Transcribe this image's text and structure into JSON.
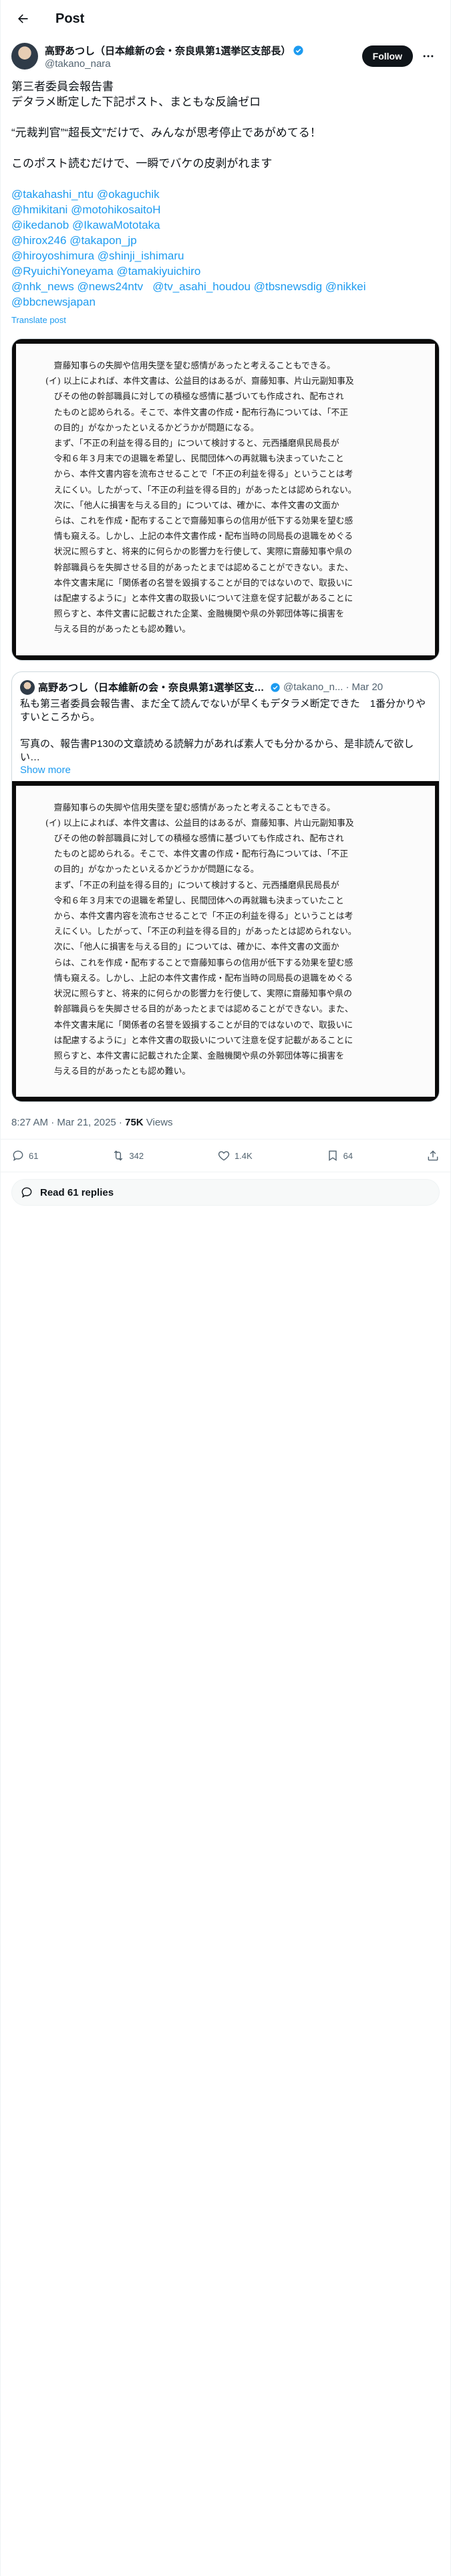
{
  "header": {
    "title": "Post"
  },
  "author": {
    "name": "高野あつし（日本維新の会・奈良県第1選挙区支部長）",
    "handle": "@takano_nara",
    "follow_label": "Follow"
  },
  "post": {
    "line1": "第三者委員会報告書",
    "line2": "デタラメ断定した下記ポスト、まともな反論ゼロ",
    "line3": "“元裁判官”“超長文”だけで、みんなが思考停止であがめてる！",
    "line4": "このポスト読むだけで、一瞬でバケの皮剥がれます",
    "mentions": [
      "@takahashi_ntu",
      "@okaguchik",
      "@hmikitani",
      "@motohikosaitoH",
      "@ikedanob",
      "@IkawaMototaka",
      "@hirox246",
      "@takapon_jp",
      "@hiroyoshimura",
      "@shinji_ishimaru",
      "@RyuichiYoneyama",
      "@tamakiyuichiro",
      "@nhk_news",
      "@news24ntv",
      "@tv_asahi_houdou",
      "@tbsnewsdig",
      "@nikkei",
      "@bbcnewsjapan"
    ],
    "translate_label": "Translate post"
  },
  "document": {
    "l1": "齋藤知事らの失脚や信用失墜を望む感情があったと考えることもできる。",
    "l2": "(イ) 以上によれば、本件文書は、公益目的はあるが、齋藤知事、片山元副知事及",
    "l3": "びその他の幹部職員に対しての積極な感情に基づいても作成され、配布され",
    "l4": "たものと認められる。そこで、本件文書の作成・配布行為については、「不正",
    "l5": "の目的」がなかったといえるかどうかが問題になる。",
    "l6": "まず、「不正の利益を得る目的」について検討すると、元西播磨県民局長が",
    "l7": "令和６年３月末での退職を希望し、民間団体への再就職も決まっていたこと",
    "l8": "から、本件文書内容を流布させることで「不正の利益を得る」ということは考",
    "l9": "えにくい。したがって、「不正の利益を得る目的」があったとは認められない。",
    "l10": "次に、「他人に損害を与える目的」については、確かに、本件文書の文面か",
    "l11": "らは、これを作成・配布することで齋藤知事らの信用が低下する効果を望む感",
    "l12": "情も窺える。しかし、上記の本件文書作成・配布当時の同局長の退職をめぐる",
    "l13": "状況に照らすと、将来的に何らかの影響力を行使して、実際に齋藤知事や県の",
    "l14": "幹部職員らを失脚させる目的があったとまでは認めることができない。また、",
    "l15": "本件文書末尾に「関係者の名誉を毀損することが目的ではないので、取扱いに",
    "l16": "は配慮するように」と本件文書の取扱いについて注意を促す記載があることに",
    "l17": "照らすと、本件文書に記載された企業、金融機関や県の外郭団体等に損害を",
    "l18": "与える目的があったとも認め難い。"
  },
  "quote": {
    "name": "高野あつし（日本維新の会・奈良県第1選挙区支部長）",
    "handle": "@takano_n...",
    "dot": "·",
    "date": "Mar 20",
    "line1": "私も第三者委員会報告書、まだ全て読んでないが早くもデタラメ断定できた　1番分かりやすいところから。",
    "line2": "写真の、報告書P130の文章読める読解力があれば素人でも分かるから、是非読んで欲しい…",
    "show_more": "Show more"
  },
  "meta": {
    "time": "8:27 AM · Mar 21, 2025",
    "sep": " · ",
    "views_count": "75K",
    "views_label": " Views"
  },
  "actions": {
    "replies": "61",
    "reposts": "342",
    "likes": "1.4K",
    "bookmarks": "64"
  },
  "read_replies": "Read 61 replies"
}
